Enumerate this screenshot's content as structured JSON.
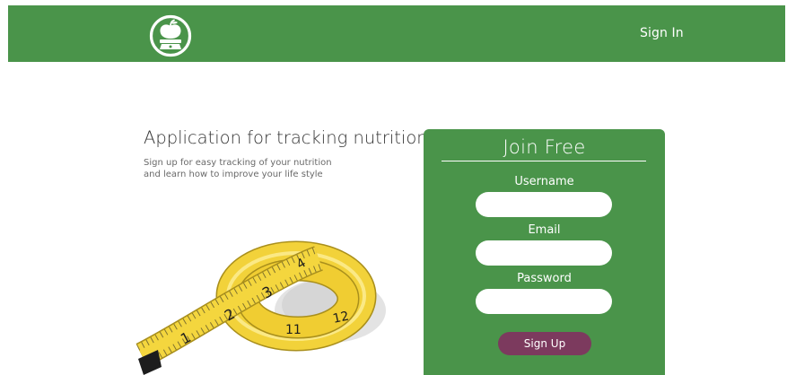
{
  "header": {
    "logo_icon": "apple-scale-icon",
    "signin_label": "Sign In"
  },
  "hero": {
    "title": "Application for tracking nutrition",
    "subtitle_line1": "Sign up for easy tracking of your nutrition",
    "subtitle_line2": "and learn how to improve your life style",
    "image_icon": "measuring-tape-icon"
  },
  "form": {
    "title": "Join Free",
    "username_label": "Username",
    "username_value": "",
    "email_label": "Email",
    "email_value": "",
    "password_label": "Password",
    "password_value": "",
    "submit_label": "Sign Up"
  },
  "colors": {
    "brand_green": "#4a944a",
    "button_plum": "#7c3a5e",
    "tape_yellow": "#f2d23a"
  }
}
